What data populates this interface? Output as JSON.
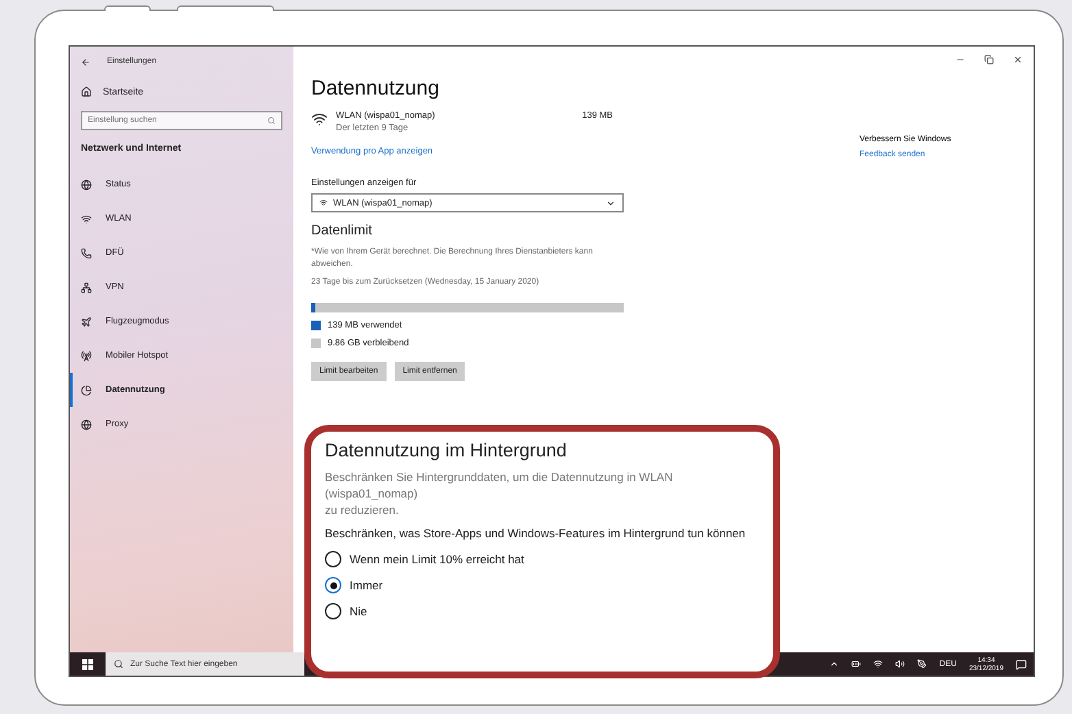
{
  "sidebar": {
    "title": "Einstellungen",
    "home": "Startseite",
    "search": {
      "placeholder": "Einstellung suchen"
    },
    "section": "Netzwerk und Internet",
    "items": [
      {
        "label": "Status",
        "selected": false
      },
      {
        "label": "WLAN",
        "selected": false
      },
      {
        "label": "DFÜ",
        "selected": false
      },
      {
        "label": "VPN",
        "selected": false
      },
      {
        "label": "Flugzeugmodus",
        "selected": false
      },
      {
        "label": "Mobiler Hotspot",
        "selected": false
      },
      {
        "label": "Datennutzung",
        "selected": true
      },
      {
        "label": "Proxy",
        "selected": false
      }
    ]
  },
  "page": {
    "title": "Datennutzung",
    "network": {
      "name": "WLAN (wispa01_nomap)",
      "period": "Der letzten 9 Tage",
      "amount": "139 MB"
    },
    "per_app_link": "Verwendung pro App anzeigen",
    "show_settings_label": "Einstellungen anzeigen für",
    "network_dropdown": "WLAN (wispa01_nomap)",
    "limit": {
      "title": "Datenlimit",
      "note": "*Wie von Ihrem Gerät berechnet. Die Berechnung Ihres Dienstanbieters kann abweichen.",
      "reset": "23 Tage bis zum Zurücksetzen (Wednesday, 15 January 2020)",
      "level": 0.014,
      "used": "139 MB verwendet",
      "remaining": "9.86 GB verbleibend",
      "buttons": [
        "Limit bearbeiten",
        "Limit entfernen"
      ]
    }
  },
  "side_panel": {
    "title": "Verbessern Sie Windows",
    "link": "Feedback senden"
  },
  "callout": {
    "title": "Datennutzung im Hintergrund",
    "description": "Beschränken Sie Hintergrunddaten, um die Datennutzung in WLAN\n(wispa01_nomap)\n zu reduzieren.",
    "question": "Beschränken, was Store-Apps und Windows-Features im Hintergrund tun können",
    "options": [
      {
        "label": "Wenn mein Limit 10% erreicht hat",
        "selected": false
      },
      {
        "label": "Immer",
        "selected": true
      },
      {
        "label": "Nie",
        "selected": false
      }
    ]
  },
  "taskbar": {
    "search_placeholder": "Zur Suche Text hier eingeben",
    "language": "DEU",
    "time": "14:34",
    "date": "23/12/2019"
  }
}
